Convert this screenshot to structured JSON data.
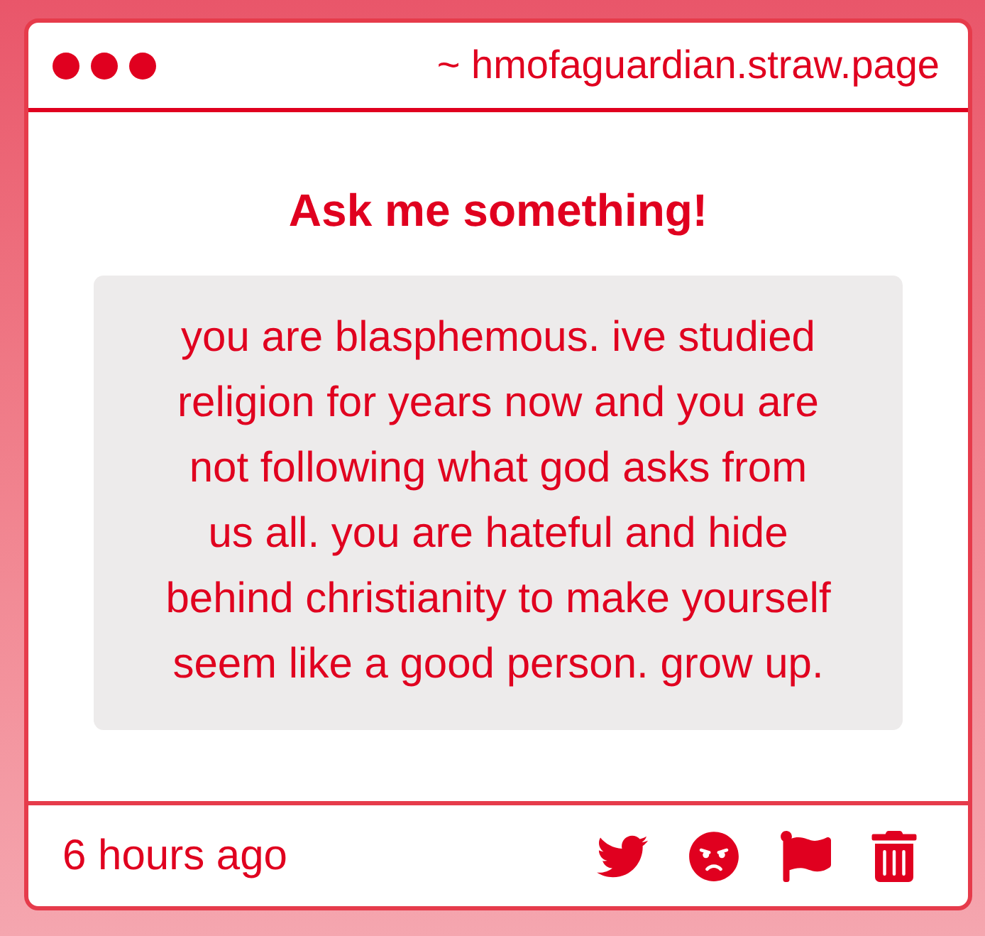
{
  "window": {
    "title": "~ hmofaguardian.straw.page"
  },
  "heading": "Ask me something!",
  "question": {
    "text": "you are blasphemous. ive studied religion for years now and you are not following what god asks from us all. you are hateful and hide behind christianity to make yourself seem like a good person. grow up."
  },
  "footer": {
    "time": "6 hours ago"
  }
}
